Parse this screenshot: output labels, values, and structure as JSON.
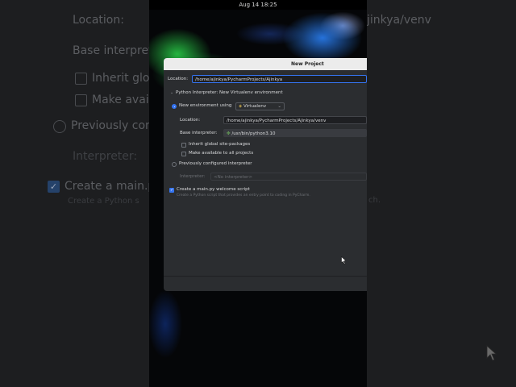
{
  "background": {
    "location_label": "Location:",
    "location_value_suffix": "jinkya/venv",
    "base_interpreter_label": "Base interpreter",
    "inherit_label": "Inherit global",
    "make_available_label": "Make availa",
    "previously_label": "Previously con",
    "interpreter_label": "Interpreter:",
    "create_main_label": "Create a main.py",
    "create_main_hint": "Create a Python s",
    "create_main_hint_right": "ch."
  },
  "status_bar": {
    "datetime": "Aug 14  18:25"
  },
  "dialog": {
    "title": "New Project",
    "location_label": "Location:",
    "location_value": "/home/ajinkya/PycharmProjects/Ajinkya",
    "interpreter_section": "Python Interpreter: New Virtualenv environment",
    "new_env_label": "New environment using",
    "env_tool": "Virtualenv",
    "venv_location_label": "Location:",
    "venv_location_value": "/home/ajinkya/PycharmProjects/Ajinkya/venv",
    "base_interpreter_label": "Base interpreter:",
    "base_interpreter_value": "/usr/bin/python3.10",
    "inherit_label": "Inherit global site-packages",
    "make_available_label": "Make available to all projects",
    "previously_label": "Previously configured interpreter",
    "interpreter_label": "Interpreter:",
    "interpreter_value": "<No interpreter>",
    "create_main_label": "Create a main.py welcome script",
    "create_main_hint": "Create a Python script that provides an entry point to coding in PyCharm."
  },
  "colors": {
    "accent": "#3574f0",
    "dialog_bg": "#2b2d30",
    "title_bg": "#ececec"
  }
}
